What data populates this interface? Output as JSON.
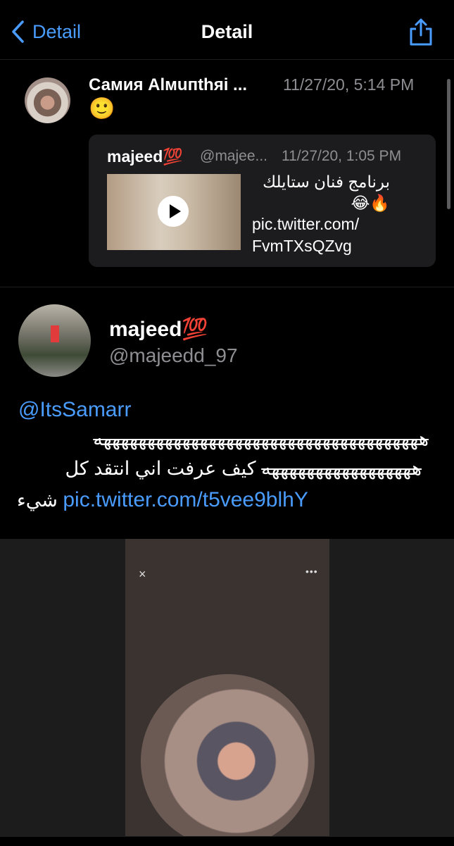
{
  "nav": {
    "back_label": "Detail",
    "title": "Detail"
  },
  "reply_tweet": {
    "author_name": "Самия Alмuпthяі ...",
    "timestamp": "11/27/20, 5:14 PM",
    "text": "🙂",
    "quoted": {
      "author_name": "majeed💯",
      "handle": "@majee...",
      "timestamp": "11/27/20, 1:05 PM",
      "text_ar": "برنامج فنان ستايلك 🔥😂",
      "link_line1": "pic.twitter.com/",
      "link_line2": "FvmTXsQZvg"
    }
  },
  "main_tweet": {
    "author_name": "majeed💯",
    "handle": "@majeedd_97",
    "mention": "@ItsSamarr",
    "line1": "هههههههههههههههههههههههههههههههههههههه",
    "line2_strike": "هههههههههههههههههه",
    "line2_rest": " كيف عرفت اني انتقد كل",
    "line3_ar": "شيء ",
    "link": "pic.twitter.com/t5vee9blhY"
  },
  "media": {
    "close_icon": "×",
    "more_icon": "•••"
  },
  "colors": {
    "accent": "#4a9cff",
    "secondary_text": "#8e8e93",
    "card_bg": "#1c1c1e"
  }
}
